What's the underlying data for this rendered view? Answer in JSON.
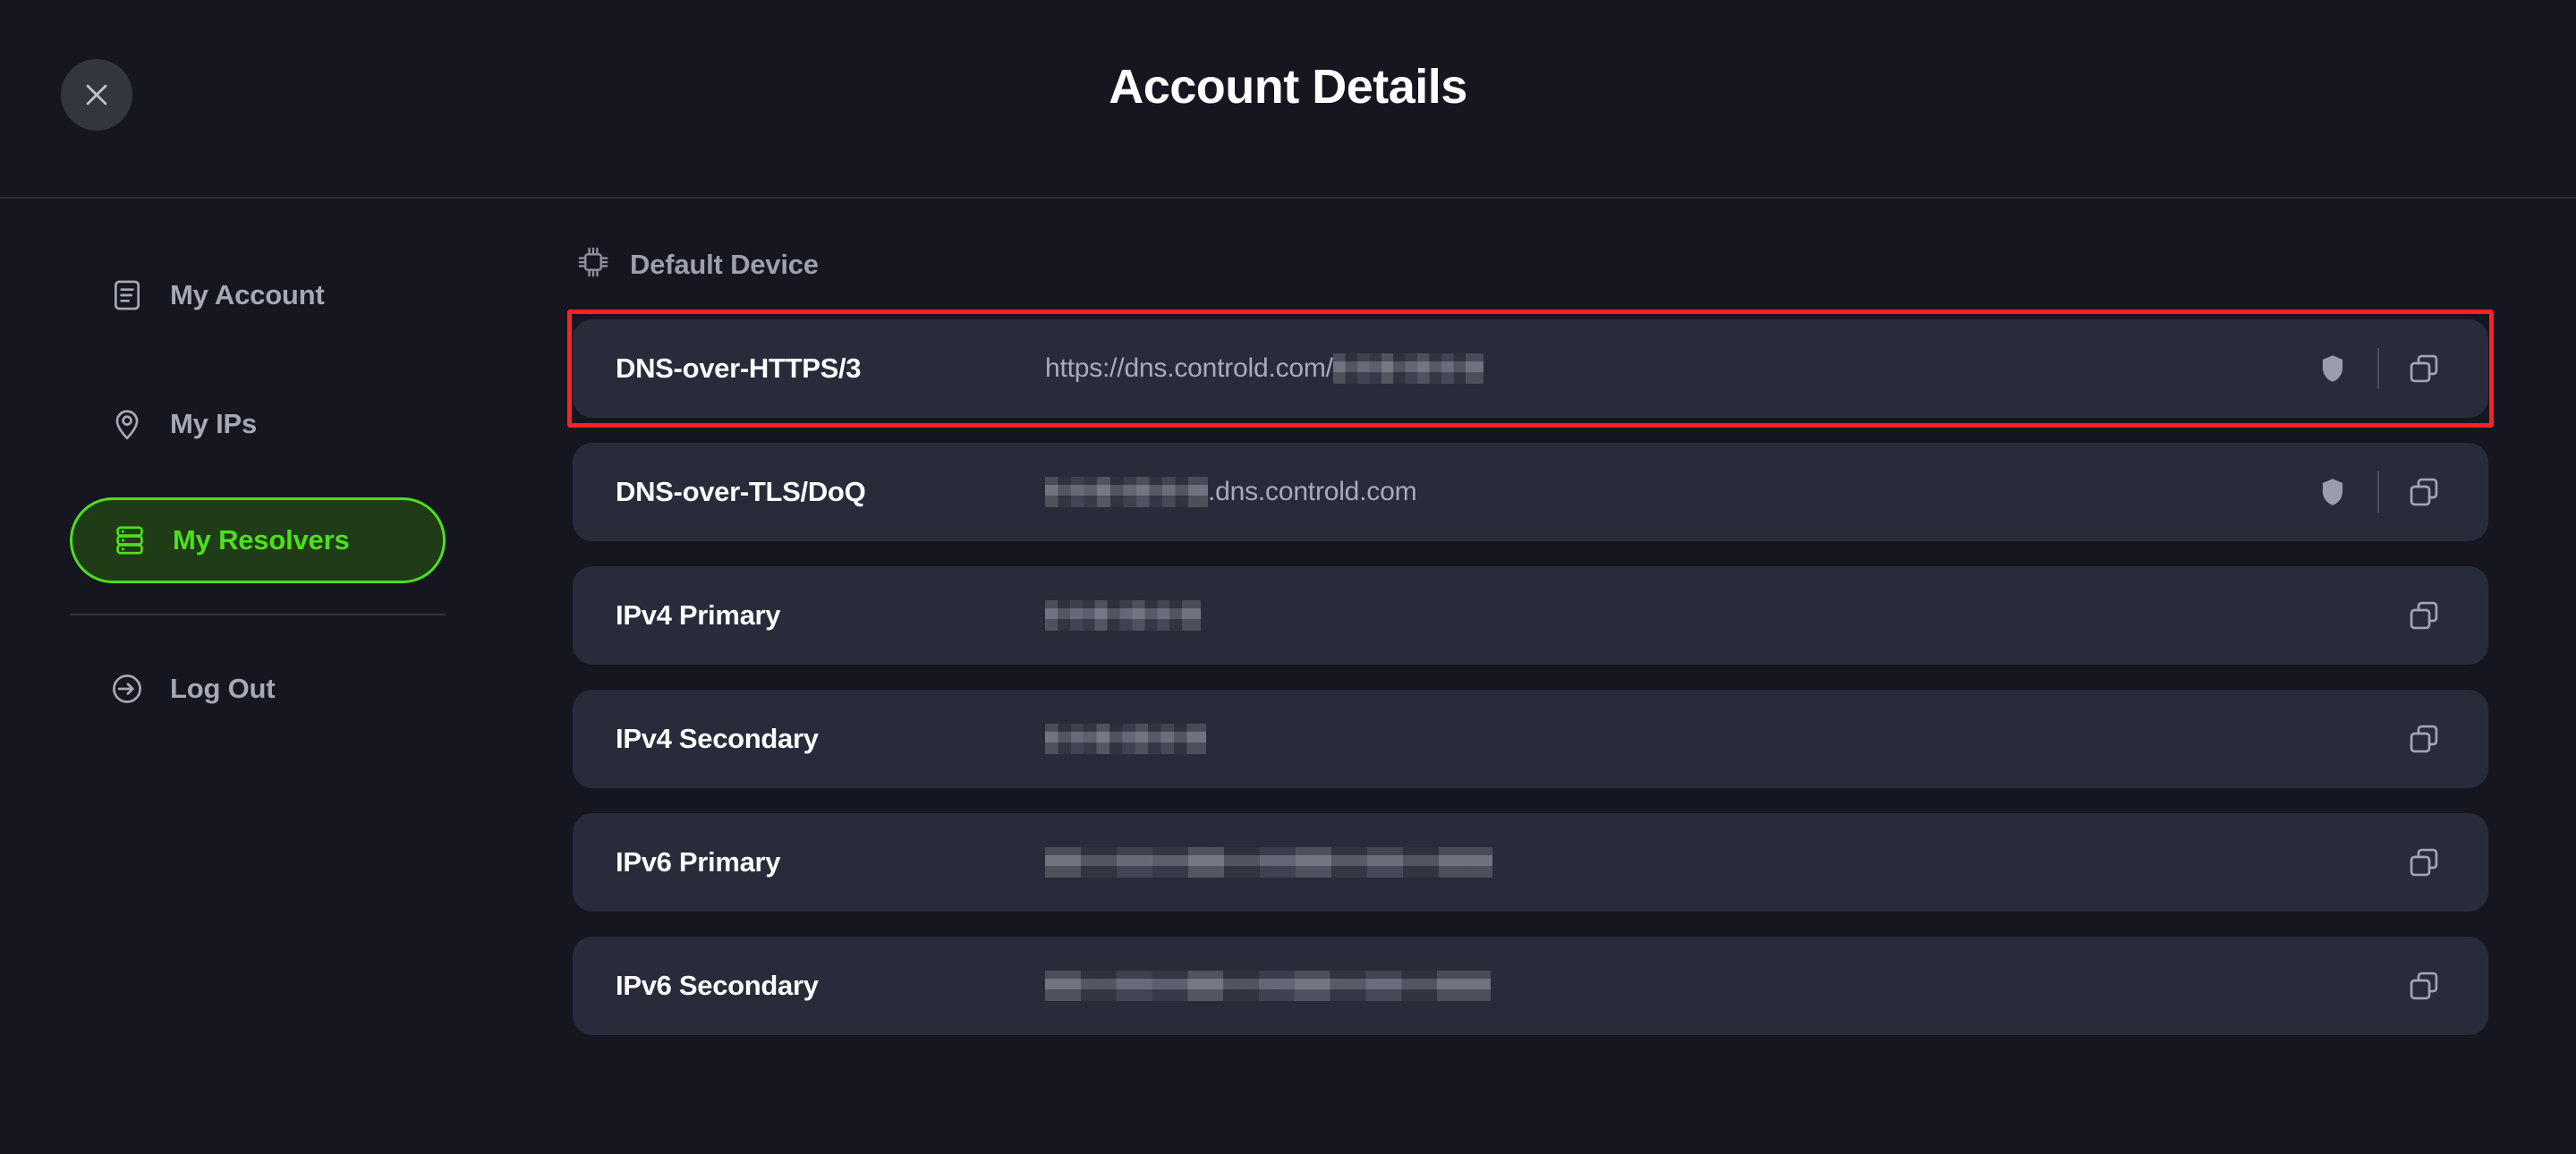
{
  "header": {
    "title": "Account Details",
    "close_label": "Close"
  },
  "sidebar": {
    "items": [
      {
        "label": "My Account",
        "icon": "document-icon",
        "active": false
      },
      {
        "label": "My IPs",
        "icon": "location-pin-icon",
        "active": false
      },
      {
        "label": "My Resolvers",
        "icon": "server-icon",
        "active": true
      },
      {
        "label": "Log Out",
        "icon": "logout-icon",
        "active": false
      }
    ],
    "active_color": "#4ee01b",
    "active_bg": "#1f3c16"
  },
  "main": {
    "section": {
      "label": "Default Device",
      "icon": "cpu-chip-icon"
    },
    "highlight_color": "#fb2222",
    "rows": [
      {
        "label": "DNS-over-HTTPS/3",
        "value_prefix": "https://dns.controld.com/",
        "value_suffix": "",
        "redacted_width": 168,
        "redacted_position": "after",
        "has_shield": true,
        "has_copy": true,
        "highlighted": true
      },
      {
        "label": "DNS-over-TLS/DoQ",
        "value_prefix": "",
        "value_suffix": ".dns.controld.com",
        "redacted_width": 182,
        "redacted_position": "before",
        "has_shield": true,
        "has_copy": true,
        "highlighted": false
      },
      {
        "label": "IPv4 Primary",
        "value_prefix": "",
        "value_suffix": "",
        "redacted_width": 174,
        "redacted_position": "only",
        "has_shield": false,
        "has_copy": true,
        "highlighted": false
      },
      {
        "label": "IPv4 Secondary",
        "value_prefix": "",
        "value_suffix": "",
        "redacted_width": 180,
        "redacted_position": "only",
        "has_shield": false,
        "has_copy": true,
        "highlighted": false
      },
      {
        "label": "IPv6 Primary",
        "value_prefix": "",
        "value_suffix": "",
        "redacted_width": 500,
        "redacted_position": "only",
        "has_shield": false,
        "has_copy": true,
        "highlighted": false
      },
      {
        "label": "IPv6 Secondary",
        "value_prefix": "",
        "value_suffix": "",
        "redacted_width": 498,
        "redacted_position": "only",
        "has_shield": false,
        "has_copy": true,
        "highlighted": false
      }
    ],
    "icons": {
      "shield": "shield-icon",
      "copy": "copy-icon"
    }
  },
  "colors": {
    "page_bg": "#15161f",
    "card_bg": "#282b3a",
    "accent_green": "#4ee01b",
    "highlight_red": "#fb2222",
    "muted_text": "#a6a9b4"
  }
}
